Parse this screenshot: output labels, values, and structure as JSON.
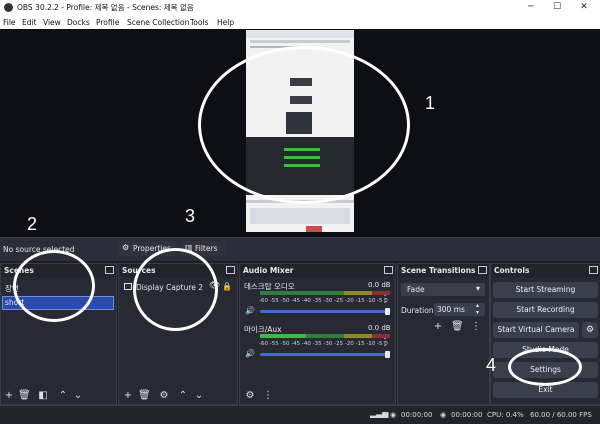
{
  "window": {
    "title": "OBS 30.2.2 - Profile: 제목 없음 - Scenes: 제목 없음",
    "minimize": "─",
    "maximize": "☐",
    "close": "✕"
  },
  "menu": [
    "File",
    "Edit",
    "View",
    "Docks",
    "Profile",
    "Scene Collection",
    "Tools",
    "Help"
  ],
  "source_toolbar": {
    "status": "No source selected",
    "properties_label": "Properties",
    "filters_label": "Filters"
  },
  "scenes": {
    "title": "Scenes",
    "items": [
      "장면",
      "short"
    ],
    "selected": "short"
  },
  "sources": {
    "title": "Sources",
    "items": [
      {
        "name": "Display Capture 2"
      }
    ]
  },
  "audio_mixer": {
    "title": "Audio Mixer",
    "channels": [
      {
        "name": "데스크탑 오디오",
        "db": "0.0 dB"
      },
      {
        "name": "마이크/Aux",
        "db": "0.0 dB"
      }
    ],
    "ticks": "-60 -55 -50 -45 -40 -35 -30 -25 -20 -15 -10 -5 0"
  },
  "transitions": {
    "title": "Scene Transitions",
    "selected": "Fade",
    "duration_label": "Duration",
    "duration_value": "300 ms"
  },
  "controls": {
    "title": "Controls",
    "start_streaming": "Start Streaming",
    "start_recording": "Start Recording",
    "start_virtual_camera": "Start Virtual Camera",
    "studio_mode": "Studio Mode",
    "settings": "Settings",
    "exit": "Exit"
  },
  "status": {
    "stream_time": "00:00:00",
    "record_time": "00:00:00",
    "cpu": "CPU: 0.4%",
    "fps": "60.00 / 60.00 FPS"
  },
  "annotations": [
    "1",
    "2",
    "3",
    "4"
  ],
  "colors": {
    "accent": "#3f6bd8",
    "panel": "#272a33",
    "meter_green": "#3db84a",
    "meter_yellow": "#c8c23a",
    "meter_red": "#c23a3a"
  }
}
